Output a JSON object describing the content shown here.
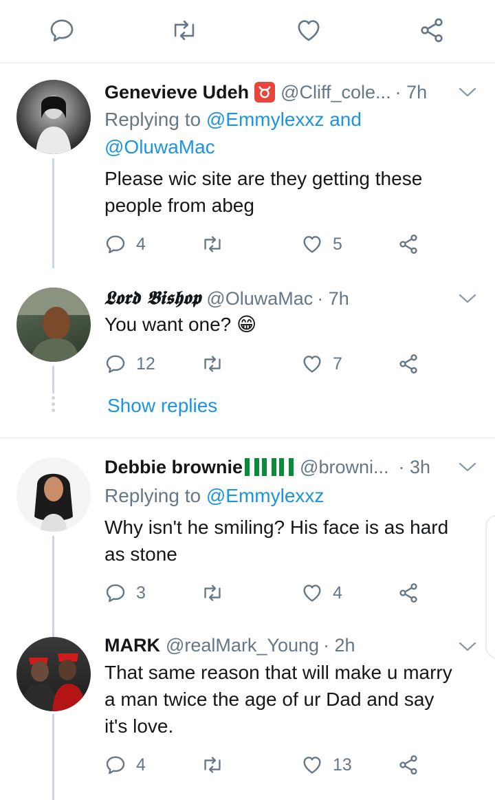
{
  "colors": {
    "accent": "#1b95e0",
    "muted": "#657786",
    "line": "#ccd6dd",
    "divider": "#e1e8ed"
  },
  "top_actions": [
    "reply-icon",
    "retweet-icon",
    "like-icon",
    "share-icon"
  ],
  "tweets": [
    {
      "name": "Genevieve Udeh",
      "name_emoji": "taurus",
      "handle": "@Cliff_cole...",
      "time": "· 7h",
      "replying_prefix": "Replying to ",
      "replying_links": "@Emmylexxz and",
      "replying_links2": "@OluwaMac",
      "text_line1": "Please wic site are they getting these",
      "text_line2": "people from abeg",
      "replies": "4",
      "retweets": "",
      "likes": "5"
    },
    {
      "name": "𝕷𝖔𝖗𝖉 𝕭𝖎𝖘𝖍𝖔𝖕",
      "handle": "@OluwaMac",
      "time": "· 7h",
      "text_line1": "You want one? 😁",
      "replies": "12",
      "retweets": "",
      "likes": "7"
    },
    {
      "name": "Debbie brownie",
      "name_emoji": "nigeria-flags",
      "handle": "@browni...",
      "time": "· 3h",
      "replying_prefix": "Replying to ",
      "replying_links": "@Emmylexxz",
      "text_line1": "Why isn't he smiling? His face is as hard",
      "text_line2": "as stone",
      "replies": "3",
      "retweets": "",
      "likes": "4"
    },
    {
      "name": "MARK",
      "handle": "@realMark_Young",
      "time": "· 2h",
      "text_line1": "That same reason that will make u marry",
      "text_line2": "a man twice the age of ur Dad and say",
      "text_line3": "it's love.",
      "replies": "4",
      "retweets": "",
      "likes": "13"
    }
  ],
  "show_replies": "Show replies"
}
